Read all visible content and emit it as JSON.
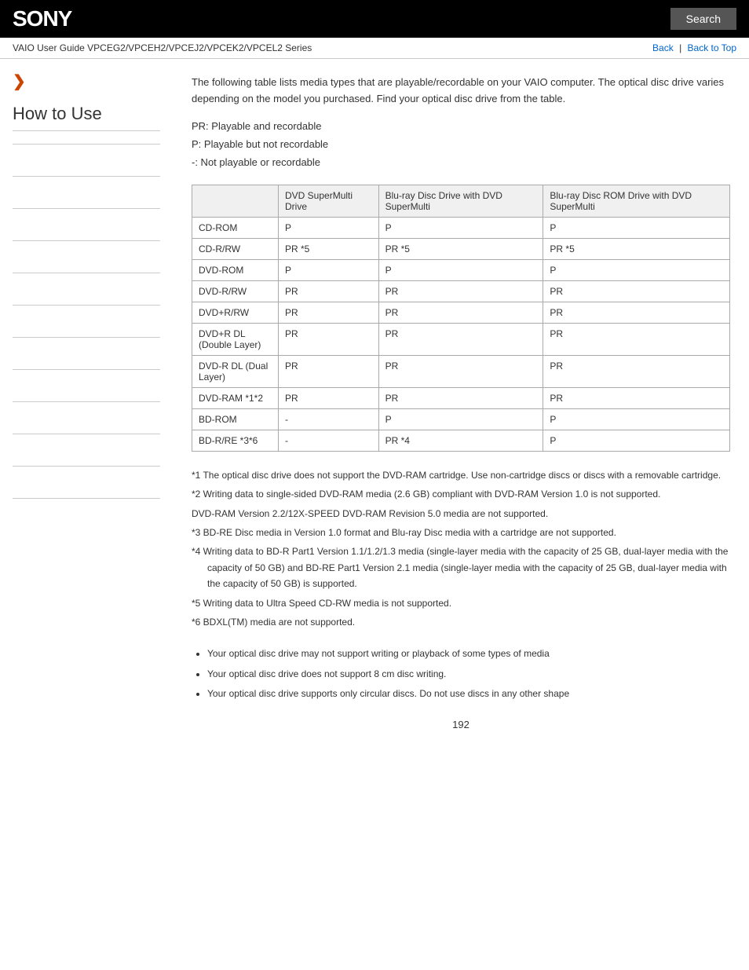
{
  "header": {
    "logo": "SONY",
    "search_label": "Search"
  },
  "nav": {
    "breadcrumb": "VAIO User Guide VPCEG2/VPCEH2/VPCEJ2/VPCEK2/VPCEL2 Series",
    "back_label": "Back",
    "back_to_top_label": "Back to Top"
  },
  "sidebar": {
    "arrow": "❯",
    "how_to_use": "How to Use",
    "lines": 12
  },
  "content": {
    "intro": "The following table lists media types that are playable/recordable on your VAIO computer. The optical disc drive varies depending on the model you purchased. Find your optical disc drive from the table.",
    "legend_pr": "PR: Playable and recordable",
    "legend_p": "P: Playable but not recordable",
    "legend_dash": "-: Not playable or recordable",
    "table_headers": [
      "",
      "DVD SuperMulti Drive",
      "Blu-ray Disc Drive with DVD SuperMulti",
      "Blu-ray Disc ROM Drive with DVD SuperMulti"
    ],
    "table_rows": [
      [
        "CD-ROM",
        "P",
        "P",
        "P"
      ],
      [
        "CD-R/RW",
        "PR *5",
        "PR *5",
        "PR *5"
      ],
      [
        "DVD-ROM",
        "P",
        "P",
        "P"
      ],
      [
        "DVD-R/RW",
        "PR",
        "PR",
        "PR"
      ],
      [
        "DVD+R/RW",
        "PR",
        "PR",
        "PR"
      ],
      [
        "DVD+R DL (Double Layer)",
        "PR",
        "PR",
        "PR"
      ],
      [
        "DVD-R DL (Dual Layer)",
        "PR",
        "PR",
        "PR"
      ],
      [
        "DVD-RAM *1*2",
        "PR",
        "PR",
        "PR"
      ],
      [
        "BD-ROM",
        "-",
        "P",
        "P"
      ],
      [
        "BD-R/RE *3*6",
        "-",
        "PR *4",
        "P"
      ]
    ],
    "footnotes": [
      "*1 The optical disc drive does not support the DVD-RAM cartridge. Use non-cartridge discs or discs with a removable cartridge.",
      "*2 Writing data to single-sided DVD-RAM media (2.6 GB) compliant with DVD-RAM Version 1.0 is not supported.",
      "DVD-RAM Version 2.2/12X-SPEED DVD-RAM Revision 5.0 media are not supported.",
      "*3 BD-RE Disc media in Version 1.0 format and Blu-ray Disc media with a cartridge are not supported.",
      "*4 Writing data to BD-R Part1 Version 1.1/1.2/1.3 media (single-layer media with the capacity of 25 GB, dual-layer media with the capacity of 50 GB) and BD-RE Part1 Version 2.1 media (single-layer media with the capacity of 25 GB, dual-layer media with the capacity of 50 GB) is supported.",
      "*5 Writing data to Ultra Speed CD-RW media is not supported.",
      "*6 BDXL(TM) media are not supported."
    ],
    "bullets": [
      "Your optical disc drive may not support writing or playback of some types of media",
      "Your optical disc drive does not support 8 cm disc writing.",
      "Your optical disc drive supports only circular discs. Do not use discs in any other shape"
    ],
    "page_number": "192"
  }
}
